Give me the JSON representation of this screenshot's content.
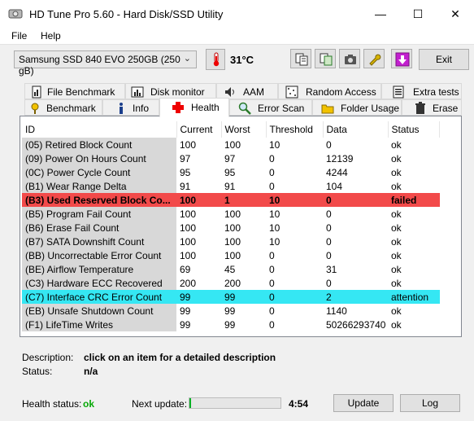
{
  "window": {
    "title": "HD Tune Pro 5.60 - Hard Disk/SSD Utility",
    "minimize": "—",
    "maximize": "☐",
    "close": "✕"
  },
  "menu": {
    "file": "File",
    "help": "Help"
  },
  "toolbar": {
    "drive": "Samsung SSD 840 EVO 250GB (250 gB)",
    "temperature": "31°C",
    "exit_label": "Exit"
  },
  "tabs_top": [
    {
      "label": "File Benchmark",
      "icon": "file-benchmark-icon"
    },
    {
      "label": "Disk monitor",
      "icon": "disk-monitor-icon"
    },
    {
      "label": "AAM",
      "icon": "speaker-icon"
    },
    {
      "label": "Random Access",
      "icon": "random-access-icon"
    },
    {
      "label": "Extra tests",
      "icon": "extra-tests-icon"
    }
  ],
  "tabs_bottom": [
    {
      "label": "Benchmark",
      "icon": "benchmark-icon"
    },
    {
      "label": "Info",
      "icon": "info-icon"
    },
    {
      "label": "Health",
      "icon": "health-cross-icon",
      "active": true
    },
    {
      "label": "Error Scan",
      "icon": "error-scan-icon"
    },
    {
      "label": "Folder Usage",
      "icon": "folder-icon"
    },
    {
      "label": "Erase",
      "icon": "trash-icon"
    }
  ],
  "table": {
    "columns": [
      "ID",
      "Current",
      "Worst",
      "Threshold",
      "Data",
      "Status"
    ],
    "rows": [
      [
        "(05) Retired Block Count",
        "100",
        "100",
        "10",
        "0",
        "ok"
      ],
      [
        "(09) Power On Hours Count",
        "97",
        "97",
        "0",
        "12139",
        "ok"
      ],
      [
        "(0C) Power Cycle Count",
        "95",
        "95",
        "0",
        "4244",
        "ok"
      ],
      [
        "(B1) Wear Range Delta",
        "91",
        "91",
        "0",
        "104",
        "ok"
      ],
      [
        "(B3) Used Reserved Block Co...",
        "100",
        "1",
        "10",
        "0",
        "failed"
      ],
      [
        "(B5) Program Fail Count",
        "100",
        "100",
        "10",
        "0",
        "ok"
      ],
      [
        "(B6) Erase Fail Count",
        "100",
        "100",
        "10",
        "0",
        "ok"
      ],
      [
        "(B7) SATA Downshift Count",
        "100",
        "100",
        "10",
        "0",
        "ok"
      ],
      [
        "(BB) Uncorrectable Error Count",
        "100",
        "100",
        "0",
        "0",
        "ok"
      ],
      [
        "(BE) Airflow Temperature",
        "69",
        "45",
        "0",
        "31",
        "ok"
      ],
      [
        "(C3) Hardware ECC Recovered",
        "200",
        "200",
        "0",
        "0",
        "ok"
      ],
      [
        "(C7) Interface CRC Error Count",
        "99",
        "99",
        "0",
        "2",
        "attention"
      ],
      [
        "(EB) Unsafe Shutdown Count",
        "99",
        "99",
        "0",
        "1140",
        "ok"
      ],
      [
        "(F1) LifeTime Writes",
        "99",
        "99",
        "0",
        "50266293740",
        "ok"
      ]
    ],
    "row_states": [
      "ok",
      "ok",
      "ok",
      "ok",
      "failed",
      "ok",
      "ok",
      "ok",
      "ok",
      "ok",
      "ok",
      "attention",
      "ok",
      "ok"
    ]
  },
  "details": {
    "description_label": "Description:",
    "description_value": "click on an item for a detailed description",
    "status_label": "Status:",
    "status_value": "n/a"
  },
  "footer": {
    "health_label": "Health status:",
    "health_value": "ok",
    "next_update_label": "Next update:",
    "next_update_value": "4:54",
    "progress": 0.02,
    "update_label": "Update",
    "log_label": "Log"
  },
  "colors": {
    "failed_row": "#f24a4a",
    "attention_row": "#35e7f3",
    "health_ok": "#07a807",
    "progress_fill": "#06b025"
  }
}
